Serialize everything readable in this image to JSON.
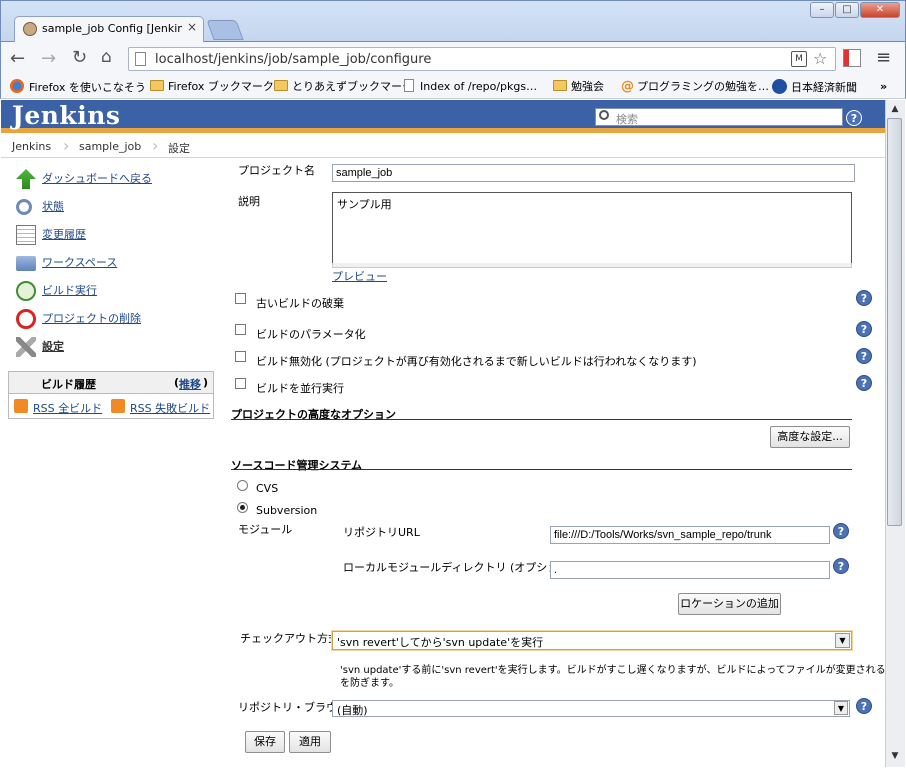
{
  "browser": {
    "tab_title": "sample_job Config [Jenkins",
    "url": "localhost/jenkins/job/sample_job/configure",
    "bookmarks": [
      "Firefox を使いこなそう",
      "Firefox ブックマーク",
      "とりあえずブックマーク",
      "Index of /repo/pkgs…",
      "勉強会",
      "プログラミングの勉強を…",
      "日本経済新聞"
    ],
    "more": "»"
  },
  "jenkins": {
    "logo": "Jenkins",
    "search_placeholder": "検索",
    "breadcrumb": [
      "Jenkins",
      "sample_job",
      "設定"
    ]
  },
  "sidebar": {
    "items": [
      {
        "label": "ダッシュボードへ戻る",
        "icon": "up-arrow-icon"
      },
      {
        "label": "状態",
        "icon": "magnifier-icon"
      },
      {
        "label": "変更履歴",
        "icon": "notepad-icon"
      },
      {
        "label": "ワークスペース",
        "icon": "folder-icon"
      },
      {
        "label": "ビルド実行",
        "icon": "clock-icon"
      },
      {
        "label": "プロジェクトの削除",
        "icon": "no-entry-icon"
      },
      {
        "label": "設定",
        "icon": "tools-icon"
      }
    ],
    "history_title": "ビルド履歴",
    "history_link": "推移",
    "history_paren_open": "(",
    "history_paren_close": ")",
    "rss_all": "RSS 全ビルド",
    "rss_fail": "RSS 失敗ビルド"
  },
  "form": {
    "project_name_label": "プロジェクト名",
    "project_name": "sample_job",
    "description_label": "説明",
    "description": "サンプル用",
    "preview": "プレビュー",
    "options": [
      {
        "label": "古いビルドの破棄",
        "checked": false
      },
      {
        "label": "ビルドのパラメータ化",
        "checked": false
      },
      {
        "label": "ビルド無効化 (プロジェクトが再び有効化されるまで新しいビルドは行われなくなります)",
        "checked": false
      },
      {
        "label": "ビルドを並行実行",
        "checked": false
      }
    ],
    "advanced_section": "プロジェクトの高度なオプション",
    "advanced_button": "高度な設定...",
    "scm_section": "ソースコード管理システム",
    "scm_cvs": "CVS",
    "scm_svn": "Subversion",
    "module_label": "モジュール",
    "repo_url_label": "リポジトリURL",
    "repo_url": "file:///D:/Tools/Works/svn_sample_repo/trunk",
    "local_dir_label": "ローカルモジュールディレクトリ (オプション)",
    "local_dir": ".",
    "add_location": "ロケーションの追加",
    "checkout_label": "チェックアウト方式",
    "checkout_value": "'svn revert'してから'svn update'を実行",
    "checkout_desc_1": "'svn update'する前に'svn revert'を実行します。ビルドがすこし遅くなりますが、ビルドによってファイルが変更されるの",
    "checkout_desc_2": "を防ぎます。",
    "repo_browser_label": "リポジトリ・ブラウザ",
    "repo_browser_value": "(自動)",
    "save": "保存",
    "apply": "適用"
  },
  "colors": {
    "jenkins_header": "#3b61a7",
    "jenkins_stripe": "#e8a43e",
    "link": "#204a87",
    "help": "#4c72b4"
  }
}
